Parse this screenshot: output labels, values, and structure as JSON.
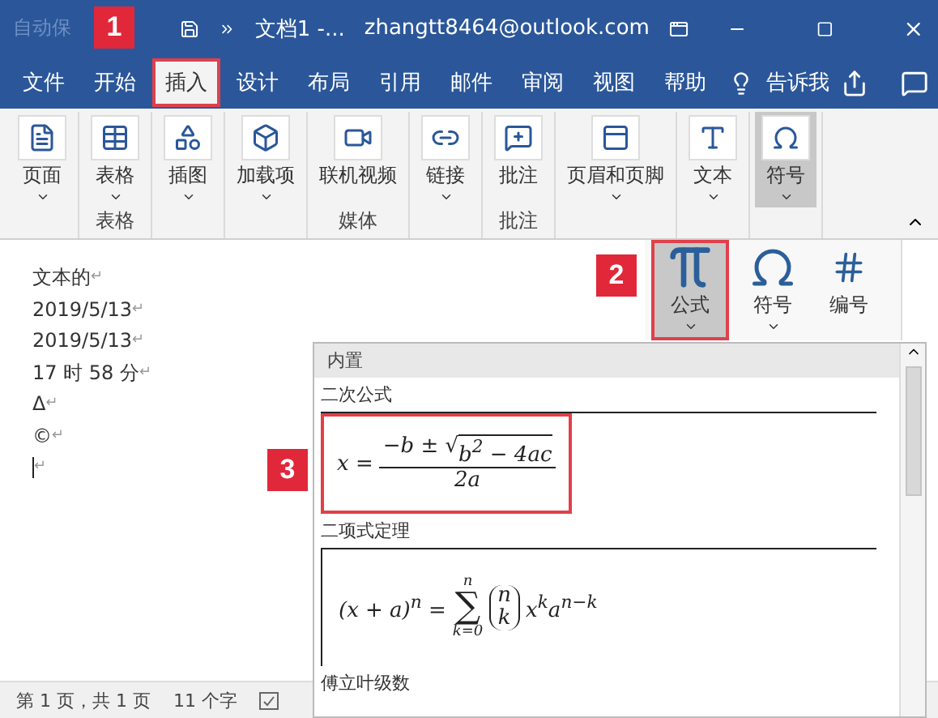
{
  "title_bar": {
    "autosave": "自动保",
    "title": "文档1 -...",
    "account": "zhangtt8464@outlook.com"
  },
  "tabs": [
    {
      "label": "文件",
      "selected": false,
      "outlined": false
    },
    {
      "label": "开始",
      "selected": false,
      "outlined": false
    },
    {
      "label": "插入",
      "selected": true,
      "outlined": true
    },
    {
      "label": "设计",
      "selected": false,
      "outlined": false
    },
    {
      "label": "布局",
      "selected": false,
      "outlined": false
    },
    {
      "label": "引用",
      "selected": false,
      "outlined": false
    },
    {
      "label": "邮件",
      "selected": false,
      "outlined": false
    },
    {
      "label": "审阅",
      "selected": false,
      "outlined": false
    },
    {
      "label": "视图",
      "selected": false,
      "outlined": false
    },
    {
      "label": "帮助",
      "selected": false,
      "outlined": false
    }
  ],
  "tell_me": "告诉我",
  "ribbon_groups": [
    {
      "buttons": [
        {
          "label": "页面",
          "dropdown": true,
          "selected": false
        }
      ]
    },
    {
      "label": "表格",
      "buttons": [
        {
          "label": "表格",
          "dropdown": true,
          "selected": false
        }
      ]
    },
    {
      "buttons": [
        {
          "label": "插图",
          "dropdown": true,
          "selected": false
        }
      ]
    },
    {
      "buttons": [
        {
          "label": "加载项",
          "dropdown": true,
          "selected": false
        }
      ]
    },
    {
      "label": "媒体",
      "buttons": [
        {
          "label": "联机视频",
          "dropdown": false,
          "selected": false
        }
      ]
    },
    {
      "buttons": [
        {
          "label": "链接",
          "dropdown": true,
          "selected": false
        }
      ]
    },
    {
      "label": "批注",
      "buttons": [
        {
          "label": "批注",
          "dropdown": false,
          "selected": false
        }
      ]
    },
    {
      "buttons": [
        {
          "label": "页眉和页脚",
          "dropdown": true,
          "selected": false
        }
      ]
    },
    {
      "buttons": [
        {
          "label": "文本",
          "dropdown": true,
          "selected": false
        }
      ]
    },
    {
      "buttons": [
        {
          "label": "符号",
          "dropdown": true,
          "selected": true
        }
      ]
    }
  ],
  "document": {
    "lines": [
      "文本的",
      "2019/5/13",
      "2019/5/13",
      "17 时 58 分",
      "Δ",
      "©"
    ],
    "paragraph_mark": "↵"
  },
  "symbols_panel": [
    {
      "label": "公式",
      "dropdown": true,
      "selected": true,
      "outlined": true
    },
    {
      "label": "符号",
      "dropdown": true,
      "selected": false,
      "outlined": false
    },
    {
      "label": "编号",
      "dropdown": false,
      "selected": false,
      "outlined": false
    }
  ],
  "equation_gallery": {
    "header": "内置",
    "items": [
      {
        "title": "二次公式",
        "kind": "quadratic",
        "outlined": true,
        "lhs": "x =",
        "numerator": "−b ±",
        "radical": "√",
        "radicand": "b$^{2}$ − 4ac",
        "denominator": "2a"
      },
      {
        "title": "二项式定理",
        "kind": "binomial",
        "outlined": false,
        "lhs": "(x + a)$^{n}$ =",
        "sum": "∑",
        "sum_upper": "n",
        "sum_lower": "k=0",
        "binom_top": "n",
        "binom_bottom": "k",
        "tail": "x$^{k}$a$^{n−k}$"
      },
      {
        "title": "傅立叶级数",
        "kind": "title_only"
      }
    ]
  },
  "status_bar": {
    "page": "第 1 页，共 1 页",
    "words": "11 个字"
  },
  "step_badges": [
    {
      "label": "1"
    },
    {
      "label": "2"
    },
    {
      "label": "3"
    }
  ]
}
